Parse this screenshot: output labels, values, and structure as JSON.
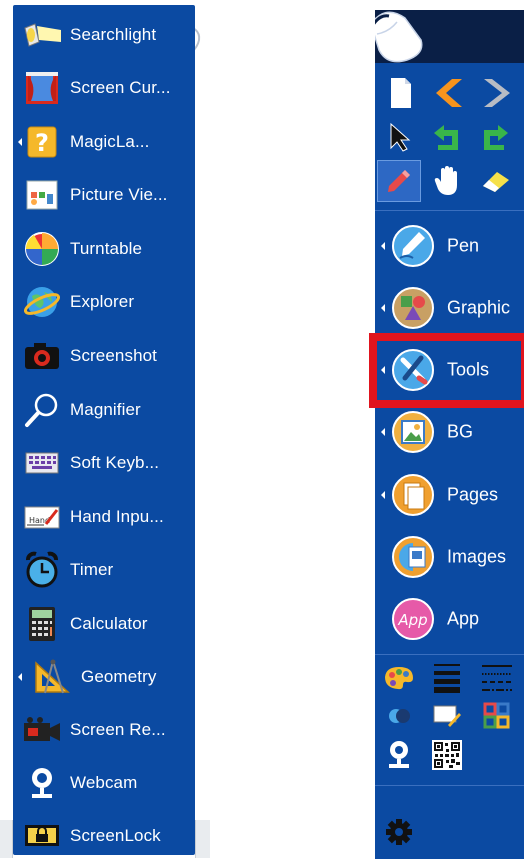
{
  "colors": {
    "panel_blue": "#0b4aa2",
    "toolbar_dark": "#0a1f46",
    "highlight_red": "#e0141e",
    "separator": "#3a6fbf"
  },
  "tools_menu": {
    "items": [
      {
        "label": "Searchlight",
        "icon": "searchlight-icon",
        "has_submenu": false
      },
      {
        "label": "Screen Cur...",
        "icon": "screen-curtain-icon",
        "has_submenu": false
      },
      {
        "label": "MagicLa...",
        "icon": "magic-lamp-icon",
        "has_submenu": true
      },
      {
        "label": "Picture Vie...",
        "icon": "picture-viewer-icon",
        "has_submenu": false
      },
      {
        "label": "Turntable",
        "icon": "turntable-icon",
        "has_submenu": false
      },
      {
        "label": "Explorer",
        "icon": "explorer-icon",
        "has_submenu": false
      },
      {
        "label": "Screenshot",
        "icon": "camera-icon",
        "has_submenu": false
      },
      {
        "label": "Magnifier",
        "icon": "magnifier-icon",
        "has_submenu": false
      },
      {
        "label": "Soft Keyb...",
        "icon": "keyboard-icon",
        "has_submenu": false
      },
      {
        "label": "Hand Inpu...",
        "icon": "hand-input-icon",
        "has_submenu": false
      },
      {
        "label": "Timer",
        "icon": "alarm-clock-icon",
        "has_submenu": false
      },
      {
        "label": "Calculator",
        "icon": "calculator-icon",
        "has_submenu": false
      },
      {
        "label": "Geometry",
        "icon": "geometry-icon",
        "has_submenu": true
      },
      {
        "label": "Screen Re...",
        "icon": "screen-recorder-icon",
        "has_submenu": false
      },
      {
        "label": "Webcam",
        "icon": "webcam-icon",
        "has_submenu": false
      },
      {
        "label": "ScreenLock",
        "icon": "lock-icon",
        "has_submenu": false
      }
    ]
  },
  "toolbar": {
    "grid_rows": [
      [
        "new-page-icon",
        "arrow-left-icon",
        "arrow-right-icon"
      ],
      [
        "cursor-icon",
        "undo-icon",
        "redo-icon"
      ],
      [
        "pen-icon",
        "hand-icon",
        "eraser-icon"
      ]
    ],
    "side_items": [
      {
        "label": "Pen",
        "icon": "pen-circle-icon",
        "has_submenu": true
      },
      {
        "label": "Graphic",
        "icon": "graphic-circle-icon",
        "has_submenu": true
      },
      {
        "label": "Tools",
        "icon": "tools-circle-icon",
        "has_submenu": true,
        "highlighted": true
      },
      {
        "label": "BG",
        "icon": "background-circle-icon",
        "has_submenu": true
      },
      {
        "label": "Pages",
        "icon": "pages-circle-icon",
        "has_submenu": true
      },
      {
        "label": "Images",
        "icon": "images-circle-icon",
        "has_submenu": false
      },
      {
        "label": "App",
        "icon": "app-circle-icon",
        "has_submenu": false
      }
    ],
    "app_icon_text": "App",
    "bottom_rows": [
      [
        "palette-icon",
        "line-weight-icon",
        "line-style-icon"
      ],
      [
        "toggle-icon",
        "screen-edit-icon",
        "layout-icon"
      ],
      [
        "webcam-icon",
        "qr-code-icon"
      ]
    ],
    "settings_icon": "gear-icon"
  }
}
